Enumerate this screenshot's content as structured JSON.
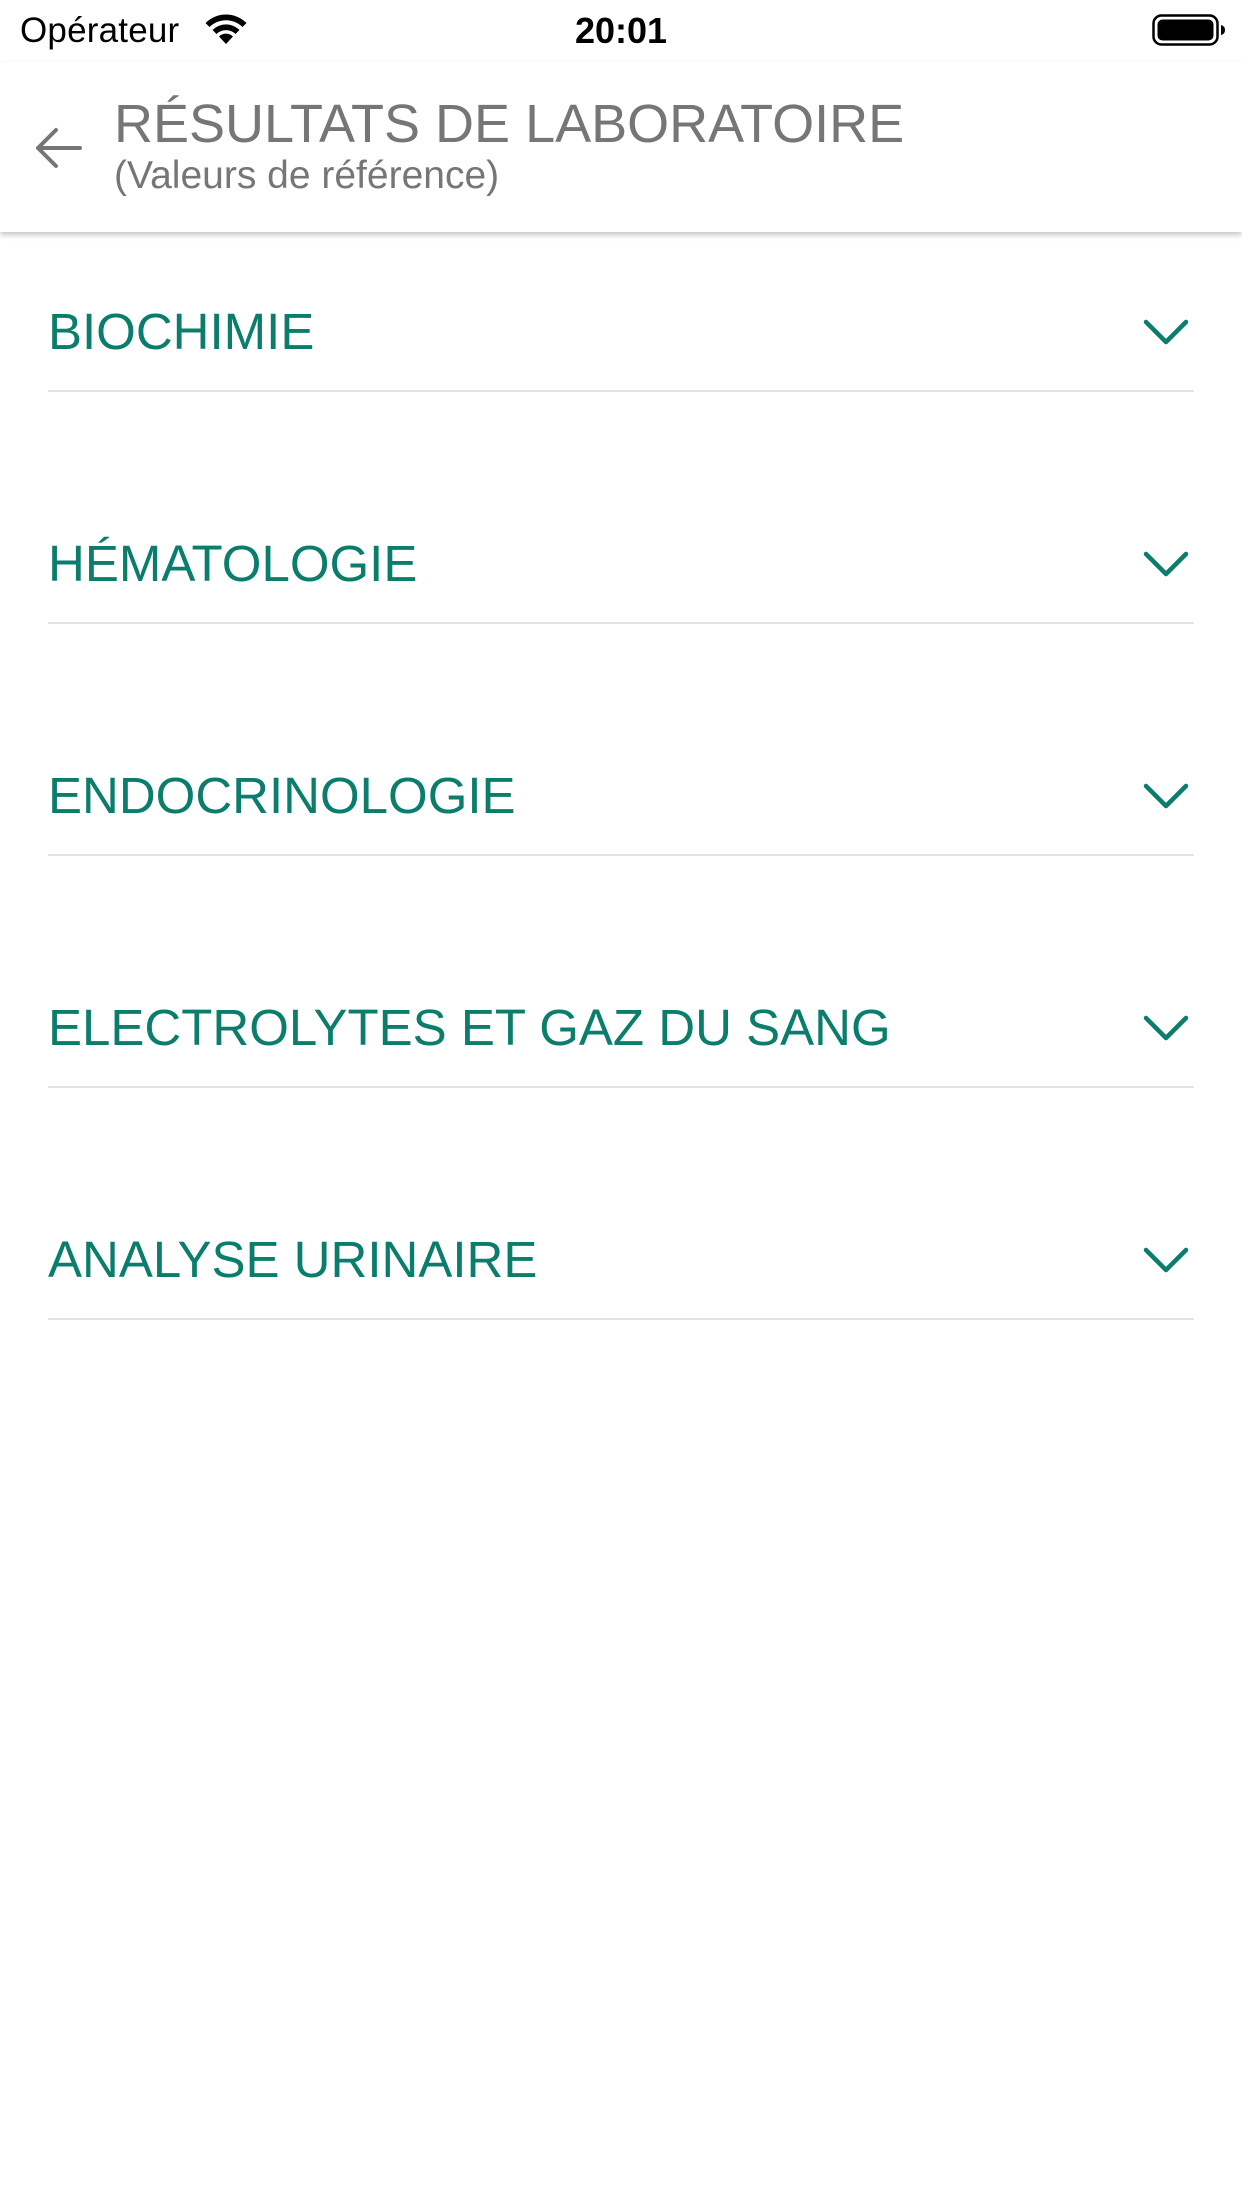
{
  "status_bar": {
    "carrier": "Opérateur",
    "time": "20:01"
  },
  "header": {
    "title": "RÉSULTATS DE LABORATOIRE",
    "subtitle": "(Valeurs de référence)"
  },
  "categories": [
    {
      "label": "BIOCHIMIE"
    },
    {
      "label": "HÉMATOLOGIE"
    },
    {
      "label": "ENDOCRINOLOGIE"
    },
    {
      "label": "ELECTROLYTES ET GAZ DU SANG"
    },
    {
      "label": "ANALYSE URINAIRE"
    }
  ],
  "colors": {
    "accent": "#0a7d6c",
    "header_text": "#767676",
    "divider": "#e2e2e2"
  }
}
